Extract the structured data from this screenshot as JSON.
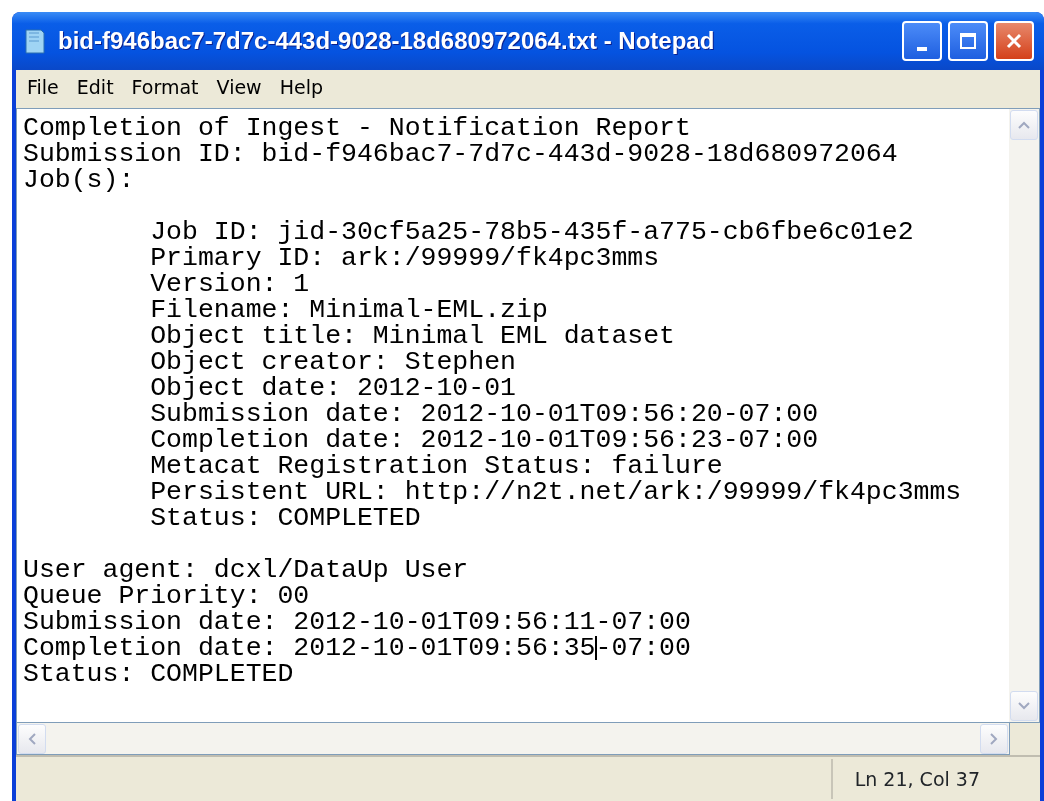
{
  "window": {
    "title": "bid-f946bac7-7d7c-443d-9028-18d680972064.txt - Notepad"
  },
  "menu": [
    "File",
    "Edit",
    "Format",
    "View",
    "Help"
  ],
  "document": {
    "header_lines": [
      "Completion of Ingest - Notification Report",
      "Submission ID: bid-f946bac7-7d7c-443d-9028-18d680972064",
      "Job(s):"
    ],
    "jobs": [
      {
        "lines": [
          "Job ID: jid-30cf5a25-78b5-435f-a775-cb6fbe6c01e2",
          "Primary ID: ark:/99999/fk4pc3mms",
          "Version: 1",
          "Filename: Minimal-EML.zip",
          "Object title: Minimal EML dataset",
          "Object creator: Stephen",
          "Object date: 2012-10-01",
          "Submission date: 2012-10-01T09:56:20-07:00",
          "Completion date: 2012-10-01T09:56:23-07:00",
          "Metacat Registration Status: failure",
          "Persistent URL: http://n2t.net/ark:/99999/fk4pc3mms",
          "Status: COMPLETED"
        ]
      }
    ],
    "trailer_lines": [
      {
        "text": "User agent: dcxl/DataUp User",
        "caret": false
      },
      {
        "text": "Queue Priority: 00",
        "caret": false
      },
      {
        "text": "Submission date: 2012-10-01T09:56:11-07:00",
        "caret": false
      },
      {
        "text": "Completion date: 2012-10-01T09:56:35-07:00",
        "caret": true
      },
      {
        "text": "Status: COMPLETED",
        "caret": false
      }
    ]
  },
  "status_bar": {
    "position": "Ln 21, Col 37"
  }
}
